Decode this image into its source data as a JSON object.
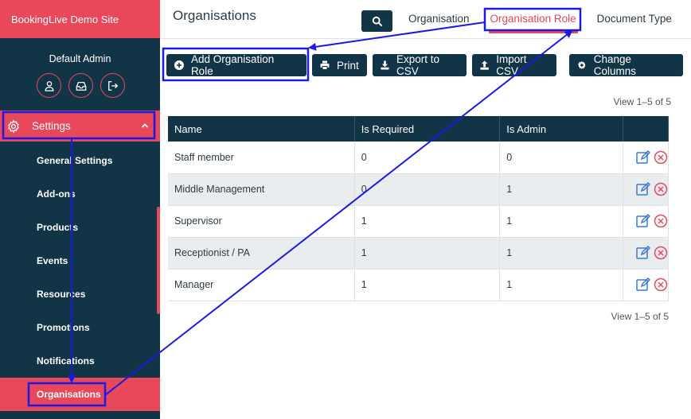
{
  "sidebar": {
    "brand": "BookingLive Demo Site",
    "admin_name": "Default Admin",
    "admin_icons": [
      "user-icon",
      "inbox-icon",
      "logout-icon"
    ],
    "settings_label": "Settings",
    "items": [
      {
        "label": "General Settings"
      },
      {
        "label": "Add-ons"
      },
      {
        "label": "Products"
      },
      {
        "label": "Events"
      },
      {
        "label": "Resources"
      },
      {
        "label": "Promotions"
      },
      {
        "label": "Notifications"
      },
      {
        "label": "Organisations"
      }
    ],
    "active_item": "Organisations"
  },
  "header": {
    "title": "Organisations",
    "tabs": [
      {
        "label": "Organisation"
      },
      {
        "label": "Organisation Role"
      },
      {
        "label": "Document Type"
      }
    ],
    "active_tab": "Organisation Role"
  },
  "toolbar": {
    "add_label": "Add Organisation Role",
    "print_label": "Print",
    "export_label": "Export to CSV",
    "import_label": "Import CSV",
    "columns_label": "Change Columns"
  },
  "table": {
    "view_top": "View 1–5 of 5",
    "view_bottom": "View 1–5 of 5",
    "headers": [
      "Name",
      "Is Required",
      "Is Admin",
      ""
    ],
    "rows": [
      {
        "name": "Staff member",
        "required": "0",
        "admin": "0"
      },
      {
        "name": "Middle Management",
        "required": "0",
        "admin": "1"
      },
      {
        "name": "Supervisor",
        "required": "1",
        "admin": "1"
      },
      {
        "name": "Receptionist / PA",
        "required": "1",
        "admin": "1"
      },
      {
        "name": "Manager",
        "required": "1",
        "admin": "1"
      }
    ]
  },
  "colors": {
    "navy": "#123447",
    "accent": "#e8485a",
    "annotation": "#1a1ae6"
  }
}
